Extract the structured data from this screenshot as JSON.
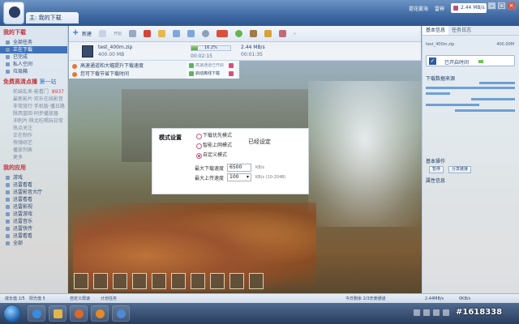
{
  "window": {
    "title_tab": "主: 我的下载",
    "right_links": [
      "提花雾海",
      "雷神"
    ],
    "speed_badge": "2.44 MB/s"
  },
  "sidebar": {
    "section1_title": "我的下载",
    "items1": [
      {
        "label": "全部任务",
        "count": ""
      },
      {
        "label": "正在下载",
        "count": ""
      },
      {
        "label": "已完成",
        "count": ""
      },
      {
        "label": "私人空间",
        "count": ""
      },
      {
        "label": "垃圾箱",
        "count": ""
      }
    ],
    "section2_title": "免费高清点播",
    "section2_badge": "第一站",
    "items2": [
      {
        "label": "前妹乱来·能看门",
        "count": "8937"
      },
      {
        "label": "最新影片·欢乐在线影音",
        "count": ""
      },
      {
        "label": "非常旅行·手机版·播日路",
        "count": ""
      },
      {
        "label": "陕西蓝田·同步播放器",
        "count": ""
      },
      {
        "label": "冲刺片·陕北吃喝玩日常",
        "count": ""
      },
      {
        "label": "热点关注",
        "count": ""
      },
      {
        "label": "正在制作",
        "count": ""
      },
      {
        "label": "快镜综艺",
        "count": ""
      },
      {
        "label": "播放列表",
        "count": ""
      },
      {
        "label": "更多",
        "count": ""
      }
    ],
    "section3_title": "我的应用",
    "items3": [
      {
        "label": "游戏"
      },
      {
        "label": "迅雷看看"
      },
      {
        "label": "迅雷影音大厅"
      },
      {
        "label": "迅雷看看"
      },
      {
        "label": "迅雷影视"
      },
      {
        "label": "迅雷游戏"
      },
      {
        "label": "迅雷音乐"
      },
      {
        "label": "迅雷快传"
      },
      {
        "label": "迅雷看看"
      },
      {
        "label": "全部"
      }
    ]
  },
  "toolbar": {
    "new_label": "新建",
    "run_label": "开始"
  },
  "download": {
    "file_name": "test_400m.zip",
    "file_size": "400.00 MB",
    "progress_pct_text": "16.2%",
    "progress_fraction": 0.162,
    "elapsed": "00:02:15",
    "speed": "2.44 MB/s",
    "remaining": "00:01:35"
  },
  "promo": {
    "line1": "高速通道和大幅提升下载速度",
    "line2": "您可下载节省下载时间",
    "toggle1": "高速通道已开启",
    "toggle2": "启动离线下载"
  },
  "dialog": {
    "title": "模式设置",
    "options": [
      "下载优先模式",
      "智能上网模式",
      "自定义模式"
    ],
    "selected_index": 2,
    "status": "已经设定",
    "download_label": "最大下载速度",
    "download_value": "6500",
    "download_unit": "KB/s",
    "upload_label": "最大上传速度",
    "upload_value": "100",
    "upload_unit": "KB/s  (10-2048)"
  },
  "right_panel": {
    "tabs": [
      "基本信息",
      "任务日志"
    ],
    "file_name": "test_400m.zip",
    "file_size": "400.00M",
    "accel_label": "已开启时间",
    "peers_title": "下载数据来源",
    "ops_title": "基本操作",
    "op_buttons": [
      "暂停",
      "分享链接"
    ],
    "info_title": "属性信息"
  },
  "statusbar": {
    "left1": "成长值 1/5",
    "left2": "阳光值 5",
    "mid1": "自定义限速",
    "mid2": "计划任务",
    "right1": "今日剩余 2/3天使通道",
    "right2": "2.44MB/s",
    "right3": "0KB/s"
  },
  "watermark": "#1618338"
}
